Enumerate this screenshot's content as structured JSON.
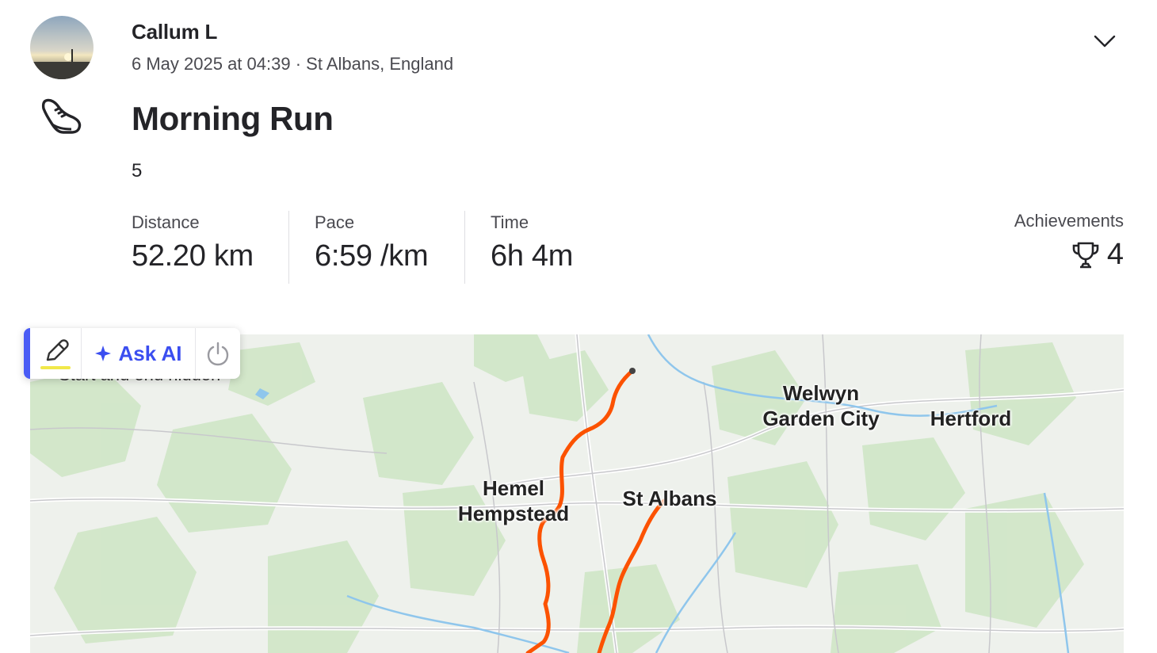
{
  "header": {
    "athlete_name": "Callum L",
    "date_time": "6 May 2025 at 04:39",
    "separator": " · ",
    "location": "St Albans, England",
    "menu_icon": "chevron-down-icon"
  },
  "activity": {
    "sport_icon": "running-shoe-icon",
    "title": "Morning Run",
    "description": "5"
  },
  "stats": [
    {
      "label": "Distance",
      "value": "52.20 km"
    },
    {
      "label": "Pace",
      "value": "6:59 /km"
    },
    {
      "label": "Time",
      "value": "6h 4m"
    }
  ],
  "achievements": {
    "label": "Achievements",
    "count": "4",
    "icon": "trophy-icon"
  },
  "toolbar": {
    "edit_icon": "pencil-icon",
    "ask_ai_label": "Ask AI",
    "ask_ai_icon": "sparkle-icon",
    "power_icon": "power-icon"
  },
  "map": {
    "partial_note": "Start and end hidden",
    "places": [
      "Welwyn\nGarden City",
      "Hertford",
      "Hemel\nHempstead",
      "St Albans"
    ],
    "route_color": "#fc5200"
  },
  "colors": {
    "accent": "#4a5cf5",
    "ai_text": "#3b4ef0",
    "route": "#fc5200"
  }
}
